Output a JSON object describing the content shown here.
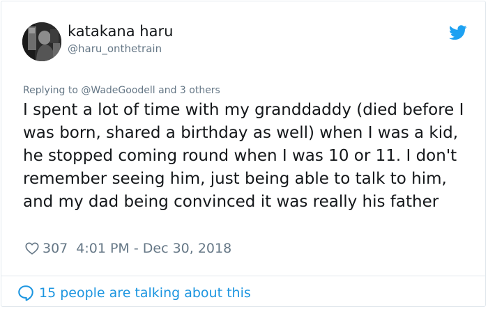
{
  "author": {
    "display_name": "katakana haru",
    "handle": "@haru_onthetrain",
    "avatar_icon": "user-avatar-photo"
  },
  "brand": {
    "icon": "twitter-bird-icon",
    "color": "#1da1f2"
  },
  "reply": {
    "text": "Replying to @WadeGoodell and 3 others"
  },
  "tweet": {
    "text": "I spent a lot of time with my granddaddy (died before I was born, shared a birthday as well) when I was a kid, he stopped coming round when I was 10 or 11. I don't remember seeing him, just being able to talk to him, and my dad being convinced it was really his father"
  },
  "meta": {
    "like_icon": "heart-icon",
    "likes": "307",
    "timestamp": "4:01 PM - Dec 30, 2018"
  },
  "footer": {
    "icon": "comment-bubble-icon",
    "talking_label": "15 people are talking about this",
    "link_color": "#1b95e0"
  },
  "colors": {
    "text_primary": "#14171a",
    "text_secondary": "#657786",
    "border": "#e1e8ed"
  }
}
